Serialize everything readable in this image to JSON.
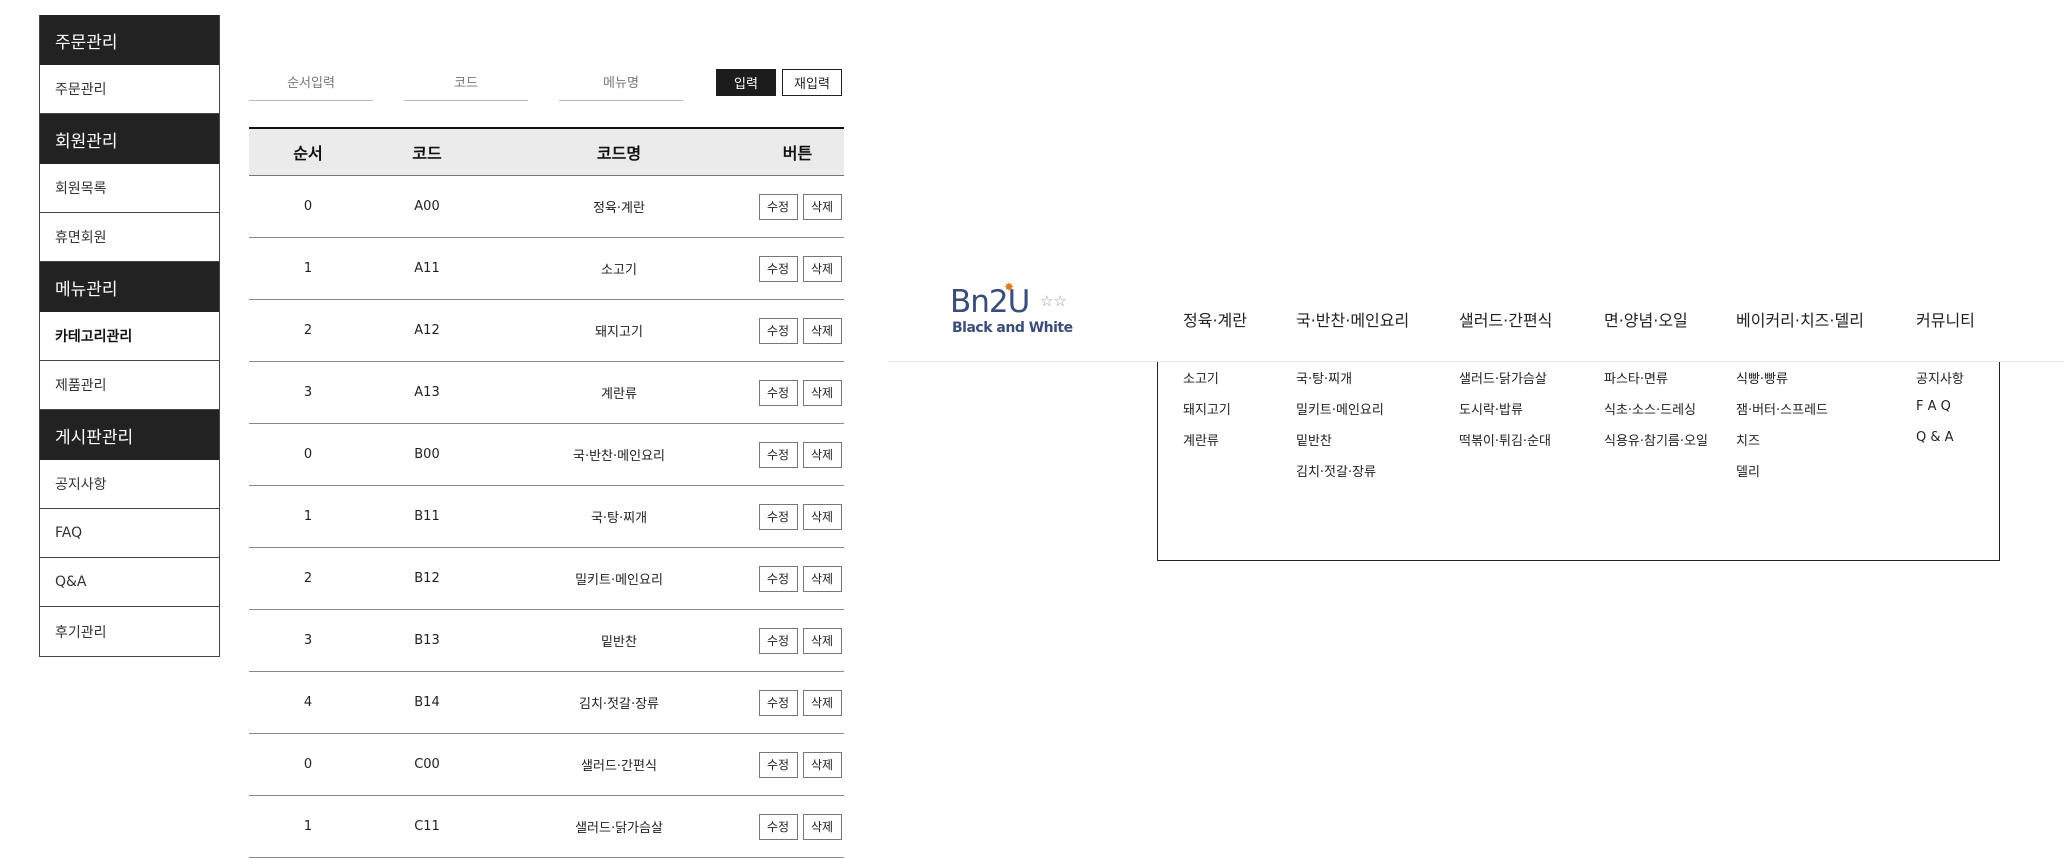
{
  "sidebar": {
    "sections": [
      {
        "title": "주문관리",
        "items": [
          "주문관리"
        ]
      },
      {
        "title": "회원관리",
        "items": [
          "회원목록",
          "휴면회원"
        ]
      },
      {
        "title": "메뉴관리",
        "items": [
          "카테고리관리",
          "제품관리"
        ]
      },
      {
        "title": "게시판관리",
        "items": [
          "공지사항",
          "FAQ",
          "Q&A",
          "후기관리"
        ]
      }
    ]
  },
  "form": {
    "order_placeholder": "순서입력",
    "code_placeholder": "코드",
    "menu_placeholder": "메뉴명",
    "submit_label": "입력",
    "reset_label": "재입력"
  },
  "table": {
    "headers": [
      "순서",
      "코드",
      "코드명",
      "버튼"
    ],
    "edit_label": "수정",
    "delete_label": "삭제",
    "rows": [
      [
        "0",
        "A00",
        "정육·계란"
      ],
      [
        "1",
        "A11",
        "소고기"
      ],
      [
        "2",
        "A12",
        "돼지고기"
      ],
      [
        "3",
        "A13",
        "계란류"
      ],
      [
        "0",
        "B00",
        "국·반찬·메인요리"
      ],
      [
        "1",
        "B11",
        "국·탕·찌개"
      ],
      [
        "2",
        "B12",
        "밀키트·메인요리"
      ],
      [
        "3",
        "B13",
        "밑반찬"
      ],
      [
        "4",
        "B14",
        "김치·젓갈·장류"
      ],
      [
        "0",
        "C00",
        "샐러드·간편식"
      ],
      [
        "1",
        "C11",
        "샐러드·닭가슴살"
      ]
    ]
  },
  "logo": {
    "main": "Bn2U",
    "sub": "Black and White"
  },
  "gnb": [
    {
      "label": "정육·계란",
      "subs": [
        "소고기",
        "돼지고기",
        "계란류"
      ]
    },
    {
      "label": "국·반찬·메인요리",
      "subs": [
        "국·탕·찌개",
        "밀키트·메인요리",
        "밑반찬",
        "김치·젓갈·장류"
      ]
    },
    {
      "label": "샐러드·간편식",
      "subs": [
        "샐러드·닭가슴살",
        "도시락·밥류",
        "떡볶이·튀김·순대"
      ]
    },
    {
      "label": "면·양념·오일",
      "subs": [
        "파스타·면류",
        "식초·소스·드레싱",
        "식용유·참기름·오일"
      ]
    },
    {
      "label": "베이커리·치즈·델리",
      "subs": [
        "식빵·빵류",
        "잼·버터·스프레드",
        "치즈",
        "델리"
      ]
    },
    {
      "label": "커뮤니티",
      "subs": [
        "공지사항",
        "F A Q",
        "Q & A"
      ]
    }
  ]
}
